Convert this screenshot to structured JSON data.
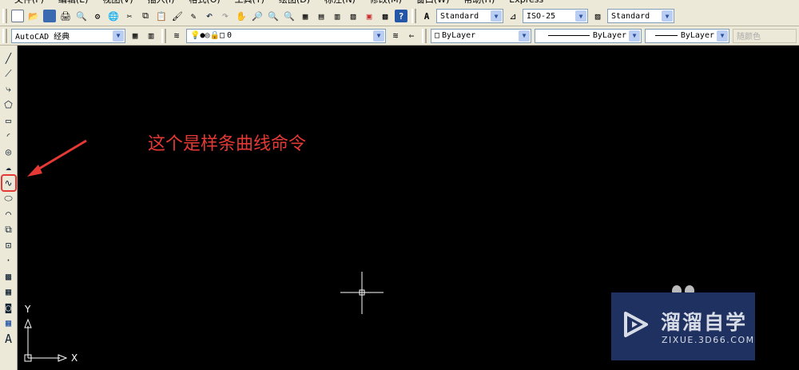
{
  "menu": [
    "文件(F)",
    "编辑(E)",
    "视图(V)",
    "插入(I)",
    "格式(O)",
    "工具(T)",
    "绘图(D)",
    "标注(N)",
    "修改(M)",
    "窗口(W)",
    "帮助(H)",
    "Express"
  ],
  "toolbar1": {
    "text_style": "Standard",
    "dim_style": "ISO-25",
    "table_style": "Standard"
  },
  "toolbar2": {
    "workspace": "AutoCAD 经典",
    "layer": "0",
    "color": "ByLayer",
    "linetype": "ByLayer",
    "lineweight": "ByLayer",
    "plotstyle": "随颜色"
  },
  "annotation": "这个是样条曲线命令",
  "ucs": {
    "x": "X",
    "y": "Y"
  },
  "watermark": {
    "name": "溜溜自学",
    "url": "ZIXUE.3D66.COM"
  },
  "colors": {
    "annotation": "#e53935",
    "watermark_bg": "#1f3160"
  }
}
